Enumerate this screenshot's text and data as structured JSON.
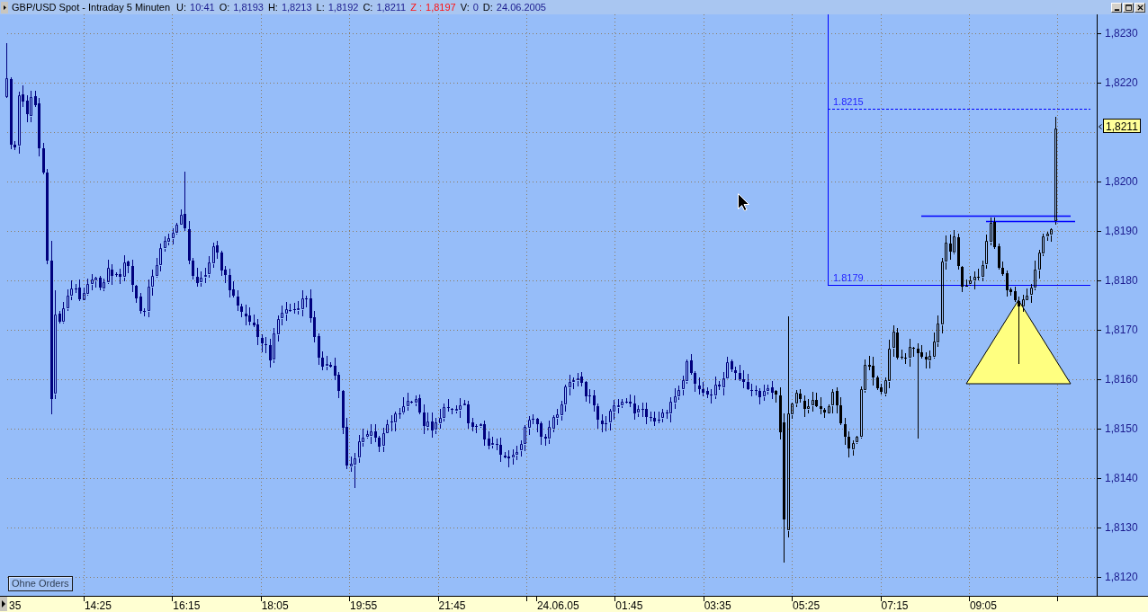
{
  "window": {
    "title": "GBP/USD Spot - Intraday 5 Minuten",
    "quote": [
      {
        "label": "U:",
        "value": "10:41",
        "highlighted": false
      },
      {
        "label": "O:",
        "value": "1,8193",
        "highlighted": false
      },
      {
        "label": "H:",
        "value": "1,8213",
        "highlighted": false
      },
      {
        "label": "L:",
        "value": "1,8192",
        "highlighted": false
      },
      {
        "label": "C:",
        "value": "1,8211",
        "highlighted": false
      },
      {
        "label": "Z :",
        "value": "1,8197",
        "highlighted": true
      },
      {
        "label": "V:",
        "value": "0",
        "highlighted": false
      },
      {
        "label": "D:",
        "value": "24.06.2005",
        "highlighted": false
      }
    ]
  },
  "chart": {
    "levels": [
      {
        "label": "1.8215",
        "kind": "dashed"
      },
      {
        "label": "1.8179",
        "kind": "solid"
      }
    ],
    "orders_button": "Ohne Orders",
    "price_axis": [
      {
        "kind": "tick",
        "label": "1,8230"
      },
      {
        "kind": "tick",
        "label": "1,8220"
      },
      {
        "kind": "tag",
        "label": "1,8211"
      },
      {
        "kind": "tick",
        "label": "1,8200"
      },
      {
        "kind": "tick",
        "label": "1,8190"
      },
      {
        "kind": "tick",
        "label": "1,8180"
      },
      {
        "kind": "tick",
        "label": "1,8170"
      },
      {
        "kind": "tick",
        "label": "1,8160"
      },
      {
        "kind": "tick",
        "label": "1,8150"
      },
      {
        "kind": "tick",
        "label": "1,8140"
      },
      {
        "kind": "tick",
        "label": "1,8130"
      },
      {
        "kind": "tick",
        "label": "1,8120"
      }
    ],
    "time_axis": [
      {
        "kind": "time",
        "label": "35"
      },
      {
        "kind": "time",
        "label": "14:25"
      },
      {
        "kind": "time",
        "label": "16:15"
      },
      {
        "kind": "time",
        "label": "18:05"
      },
      {
        "kind": "time",
        "label": "19:55"
      },
      {
        "kind": "time",
        "label": "21:45"
      },
      {
        "kind": "date",
        "label": "24.06.05"
      },
      {
        "kind": "time",
        "label": "01:45"
      },
      {
        "kind": "time",
        "label": "03:35"
      },
      {
        "kind": "time",
        "label": "05:25"
      },
      {
        "kind": "time",
        "label": "07:15"
      },
      {
        "kind": "time",
        "label": "09:05"
      }
    ]
  }
}
